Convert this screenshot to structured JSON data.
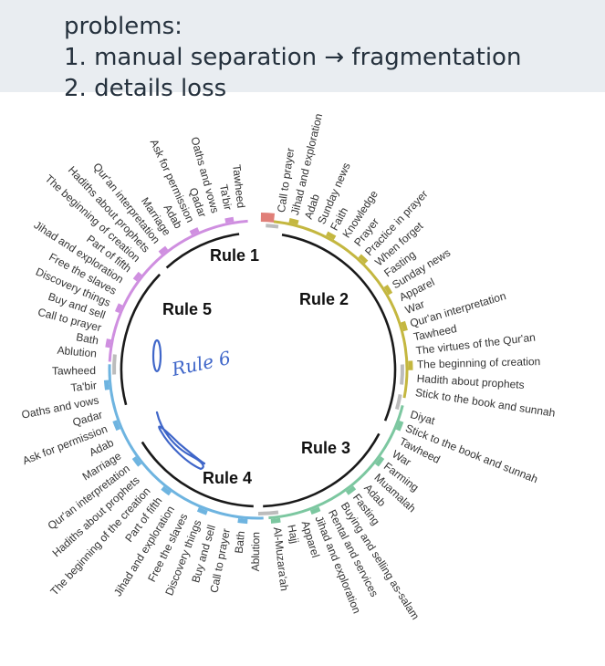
{
  "header": {
    "line1": "problems:",
    "line2": "1. manual separation → fragmentation",
    "line3": "2. details loss"
  },
  "rules": [
    "Rule 1",
    "Rule 2",
    "Rule 3",
    "Rule 4",
    "Rule 5"
  ],
  "annotation": "Rule 6",
  "colors": {
    "group1": "#e07f78",
    "group2": "#c4b740",
    "group3": "#7cc7a0",
    "group4": "#6eb4e0",
    "group5": "#cf8fe0",
    "gray": "#bcbcbc",
    "ink": "#3f66c9",
    "header_bg": "#e9edf1"
  },
  "groups": [
    [
      "Call to prayer",
      "Jihad and exploration",
      "Adab",
      "Sunday news",
      "Faith",
      "Knowledge",
      "Prayer",
      "Practice in prayer",
      "When forget",
      "Fasting",
      "Sunday news",
      "Apparel",
      "War",
      "Qur'an interpretation",
      "Tawheed",
      "The virtues of the Qur'an",
      "The beginning of creation",
      "Hadith about prophets",
      "Stick to the book and sunnah"
    ],
    [
      "Diyat",
      "Stick to the book and sunnah",
      "Tawheed",
      "War",
      "Farming",
      "Muamalah",
      "Adab",
      "Fasting",
      "Buying and selling as-salam",
      "Rental and services",
      "Jihad and exploration",
      "Apparel",
      "Hajj",
      "Al-Muzara'ah"
    ],
    [
      "Ablution",
      "Bath",
      "Call to prayer",
      "Buy and sell",
      "Discovery things",
      "Free the slaves",
      "Jihad and exploration",
      "Part of fifth",
      "The beginning of the creation",
      "Hadiths about prophets",
      "Qur'an interpretation",
      "Marriage",
      "Adab",
      "Ask for permission",
      "Qadar",
      "Oaths and vows",
      "Ta'bir",
      "Tawheed"
    ],
    [
      "Ablution",
      "Bath",
      "Call to prayer",
      "Buy and sell",
      "Discovery things",
      "Free the slaves",
      "Jihad and exploration",
      "Part of fifth",
      "The beginning of creation",
      "Hadiths about prophets",
      "Qur'an interpretation",
      "Marriage",
      "Adab",
      "Ask for permission",
      "Qadar",
      "Oaths and vows",
      "Ta'bir",
      "Tawheed"
    ]
  ]
}
